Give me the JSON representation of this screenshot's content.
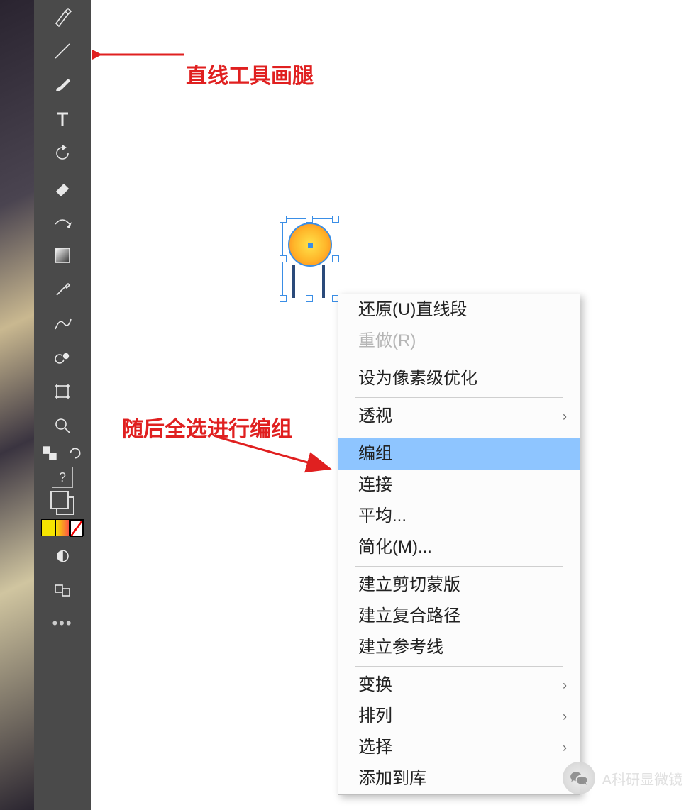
{
  "annotations": {
    "top": "直线工具画腿",
    "mid": "随后全选进行编组"
  },
  "tools": [
    {
      "name": "pen-tool"
    },
    {
      "name": "line-tool"
    },
    {
      "name": "brush-tool"
    },
    {
      "name": "type-tool"
    },
    {
      "name": "rotate-tool"
    },
    {
      "name": "eraser-tool"
    },
    {
      "name": "width-tool"
    },
    {
      "name": "gradient-tool"
    },
    {
      "name": "eyedropper-tool"
    },
    {
      "name": "blend-tool"
    },
    {
      "name": "symbol-sprayer-tool"
    },
    {
      "name": "artboard-tool"
    },
    {
      "name": "zoom-tool"
    }
  ],
  "swatches": {
    "a": "#f5e400",
    "b": "#f59a00",
    "c": "#ffffff"
  },
  "context_menu": {
    "items": [
      {
        "label": "还原(U)直线段",
        "state": "normal"
      },
      {
        "label": "重做(R)",
        "state": "disabled"
      },
      {
        "sep": true
      },
      {
        "label": "设为像素级优化",
        "state": "normal"
      },
      {
        "sep": true
      },
      {
        "label": "透视",
        "state": "normal",
        "submenu": true
      },
      {
        "sep": true
      },
      {
        "label": "编组",
        "state": "selected"
      },
      {
        "label": "连接",
        "state": "normal"
      },
      {
        "label": "平均...",
        "state": "normal"
      },
      {
        "label": "简化(M)...",
        "state": "normal"
      },
      {
        "sep": true
      },
      {
        "label": "建立剪切蒙版",
        "state": "normal"
      },
      {
        "label": "建立复合路径",
        "state": "normal"
      },
      {
        "label": "建立参考线",
        "state": "normal"
      },
      {
        "sep": true
      },
      {
        "label": "变换",
        "state": "normal",
        "submenu": true
      },
      {
        "label": "排列",
        "state": "normal",
        "submenu": true
      },
      {
        "label": "选择",
        "state": "normal",
        "submenu": true
      },
      {
        "label": "添加到库",
        "state": "normal"
      }
    ]
  },
  "watermark": {
    "text": "A科研显微镜"
  },
  "misc": {
    "qmark": "?"
  }
}
